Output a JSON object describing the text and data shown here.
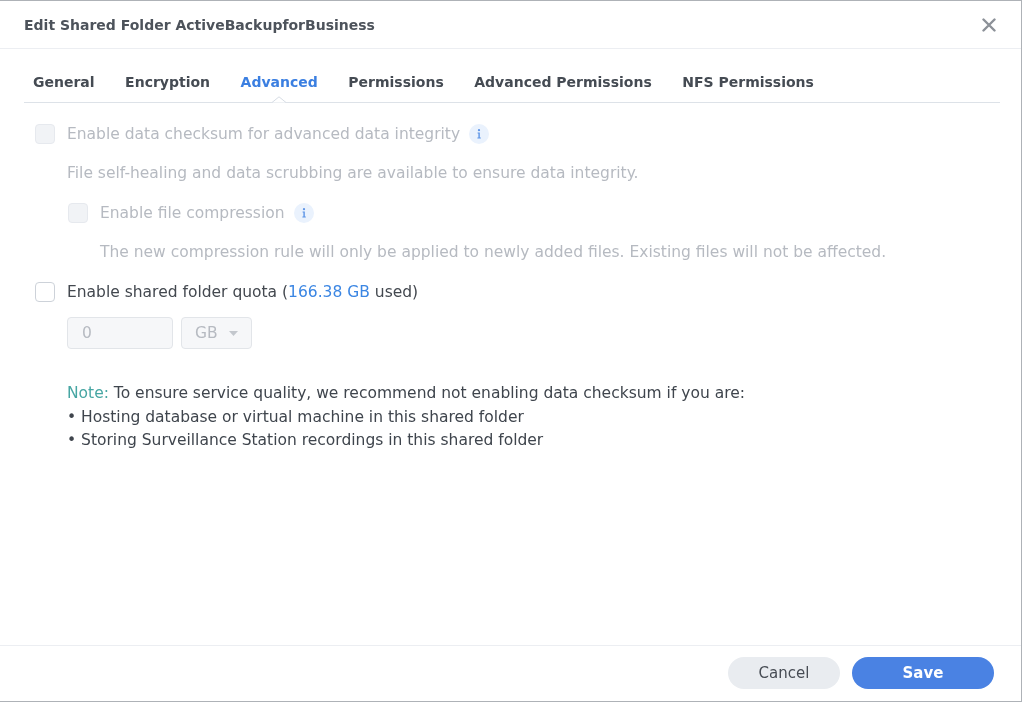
{
  "window": {
    "title": "Edit Shared Folder ActiveBackupforBusiness"
  },
  "tabs": [
    {
      "label": "General",
      "selected": false
    },
    {
      "label": "Encryption",
      "selected": false
    },
    {
      "label": "Advanced",
      "selected": true
    },
    {
      "label": "Permissions",
      "selected": false
    },
    {
      "label": "Advanced Permissions",
      "selected": false
    },
    {
      "label": "NFS Permissions",
      "selected": false
    }
  ],
  "options": [
    {
      "kind": "checkbox",
      "label": "Enable data checksum for advanced data integrity",
      "checked": false,
      "disabled": true,
      "has_info": true,
      "description": "File self-healing and data scrubbing are available to ensure data integrity.",
      "children": [
        {
          "kind": "checkbox",
          "label": "Enable file compression",
          "checked": false,
          "disabled": true,
          "has_info": true,
          "description": "The new compression rule will only be applied to newly added files. Existing files will not be affected."
        }
      ]
    },
    {
      "kind": "quota",
      "label_parts": [
        {
          "text": "Enable shared folder quota (",
          "highlight": false
        },
        {
          "text": "166.38 GB",
          "highlight": true
        },
        {
          "text": " used)",
          "highlight": false
        }
      ],
      "checked": false,
      "disabled": false,
      "size_field": {
        "value": "0",
        "disabled": true
      },
      "unit_select": {
        "value": "GB",
        "disabled": true
      }
    }
  ],
  "note": {
    "label": "Note:",
    "text": "To ensure service quality, we recommend not enabling data checksum if you are:",
    "items": [
      "• Hosting database or virtual machine in this shared folder",
      "• Storing Surveillance Station recordings in this shared folder"
    ]
  },
  "buttons": [
    {
      "label": "Cancel",
      "kind": "secondary"
    },
    {
      "label": "Save",
      "kind": "primary"
    }
  ]
}
